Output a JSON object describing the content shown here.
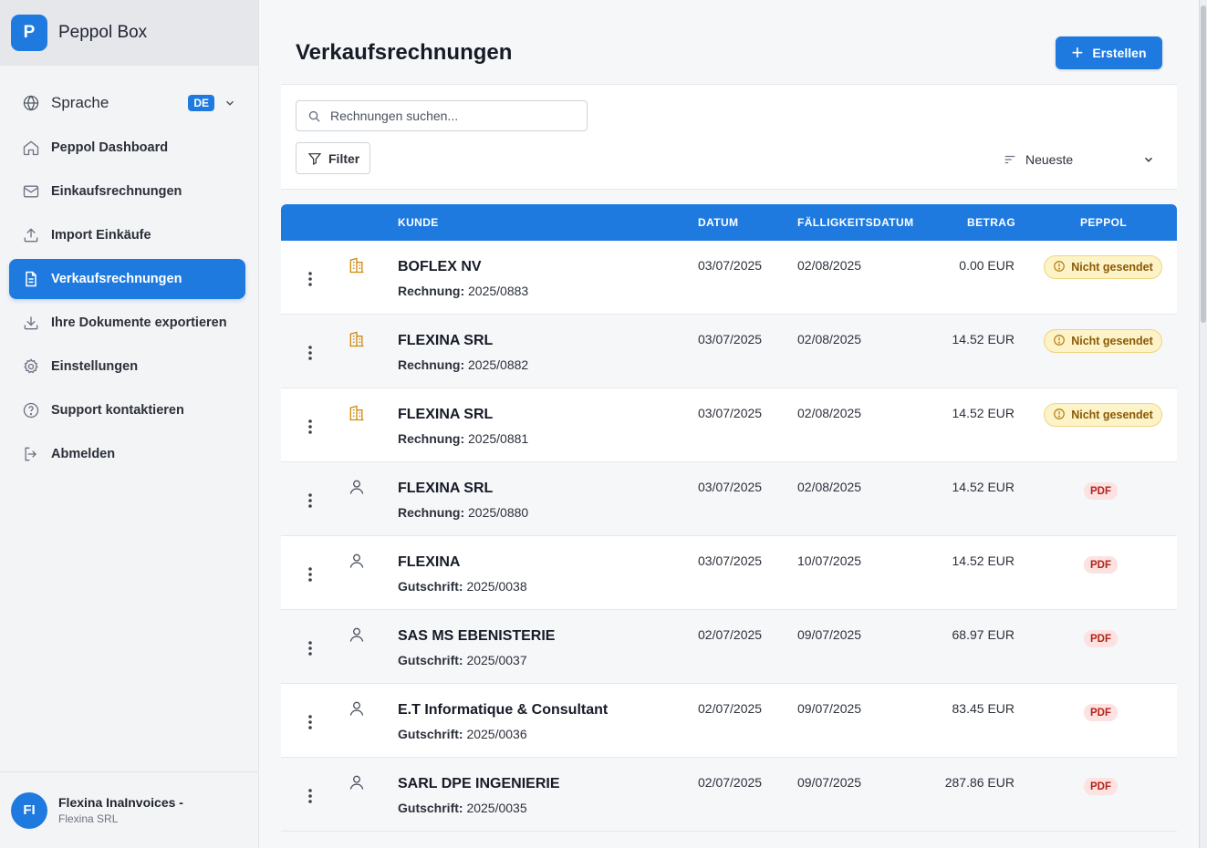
{
  "app": {
    "name": "Peppol Box",
    "logo_letter": "P"
  },
  "sidebar": {
    "language": {
      "label": "Sprache",
      "value": "DE"
    },
    "items": [
      {
        "label": "Peppol Dashboard",
        "icon": "home-icon",
        "active": false
      },
      {
        "label": "Einkaufsrechnungen",
        "icon": "mail-icon",
        "active": false
      },
      {
        "label": "Import Einkäufe",
        "icon": "upload-icon",
        "active": false
      },
      {
        "label": "Verkaufsrechnungen",
        "icon": "document-icon",
        "active": true
      },
      {
        "label": "Ihre Dokumente exportieren",
        "icon": "download-icon",
        "active": false
      },
      {
        "label": "Einstellungen",
        "icon": "gear-icon",
        "active": false
      },
      {
        "label": "Support kontaktieren",
        "icon": "help-icon",
        "active": false
      },
      {
        "label": "Abmelden",
        "icon": "logout-icon",
        "active": false
      }
    ],
    "user": {
      "initials": "FI",
      "name": "Flexina InaInvoices -",
      "org": "Flexina SRL"
    }
  },
  "main": {
    "title": "Verkaufsrechnungen",
    "create_label": "Erstellen",
    "search_placeholder": "Rechnungen suchen...",
    "filter_label": "Filter",
    "sort_label": "Neueste",
    "columns": {
      "customer": "KUNDE",
      "date": "DATUM",
      "due": "FÄLLIGKEITSDATUM",
      "amount": "BETRAG",
      "peppol": "PEPPOL"
    },
    "rows": [
      {
        "type": "building",
        "customer": "BOFLEX NV",
        "doc_kind": "Rechnung:",
        "doc_no": "2025/0883",
        "date": "03/07/2025",
        "due": "02/08/2025",
        "amount": "0.00 EUR",
        "status": "Nicht gesendet",
        "status_kind": "warn"
      },
      {
        "type": "building",
        "customer": "FLEXINA SRL",
        "doc_kind": "Rechnung:",
        "doc_no": "2025/0882",
        "date": "03/07/2025",
        "due": "02/08/2025",
        "amount": "14.52 EUR",
        "status": "Nicht gesendet",
        "status_kind": "warn"
      },
      {
        "type": "building",
        "customer": "FLEXINA SRL",
        "doc_kind": "Rechnung:",
        "doc_no": "2025/0881",
        "date": "03/07/2025",
        "due": "02/08/2025",
        "amount": "14.52 EUR",
        "status": "Nicht gesendet",
        "status_kind": "warn"
      },
      {
        "type": "person",
        "customer": "FLEXINA SRL",
        "doc_kind": "Rechnung:",
        "doc_no": "2025/0880",
        "date": "03/07/2025",
        "due": "02/08/2025",
        "amount": "14.52 EUR",
        "status": "PDF",
        "status_kind": "pdf"
      },
      {
        "type": "person",
        "customer": "FLEXINA",
        "doc_kind": "Gutschrift:",
        "doc_no": "2025/0038",
        "date": "03/07/2025",
        "due": "10/07/2025",
        "amount": "14.52 EUR",
        "status": "PDF",
        "status_kind": "pdf"
      },
      {
        "type": "person",
        "customer": "SAS MS EBENISTERIE",
        "doc_kind": "Gutschrift:",
        "doc_no": "2025/0037",
        "date": "02/07/2025",
        "due": "09/07/2025",
        "amount": "68.97 EUR",
        "status": "PDF",
        "status_kind": "pdf"
      },
      {
        "type": "person",
        "customer": "E.T Informatique & Consultant",
        "doc_kind": "Gutschrift:",
        "doc_no": "2025/0036",
        "date": "02/07/2025",
        "due": "09/07/2025",
        "amount": "83.45 EUR",
        "status": "PDF",
        "status_kind": "pdf"
      },
      {
        "type": "person",
        "customer": "SARL DPE INGENIERIE",
        "doc_kind": "Gutschrift:",
        "doc_no": "2025/0035",
        "date": "02/07/2025",
        "due": "09/07/2025",
        "amount": "287.86 EUR",
        "status": "PDF",
        "status_kind": "pdf"
      }
    ]
  },
  "colors": {
    "accent": "#1f7ae0",
    "warn_bg": "#fdf3c8",
    "pdf_bg": "#fde2e2"
  }
}
